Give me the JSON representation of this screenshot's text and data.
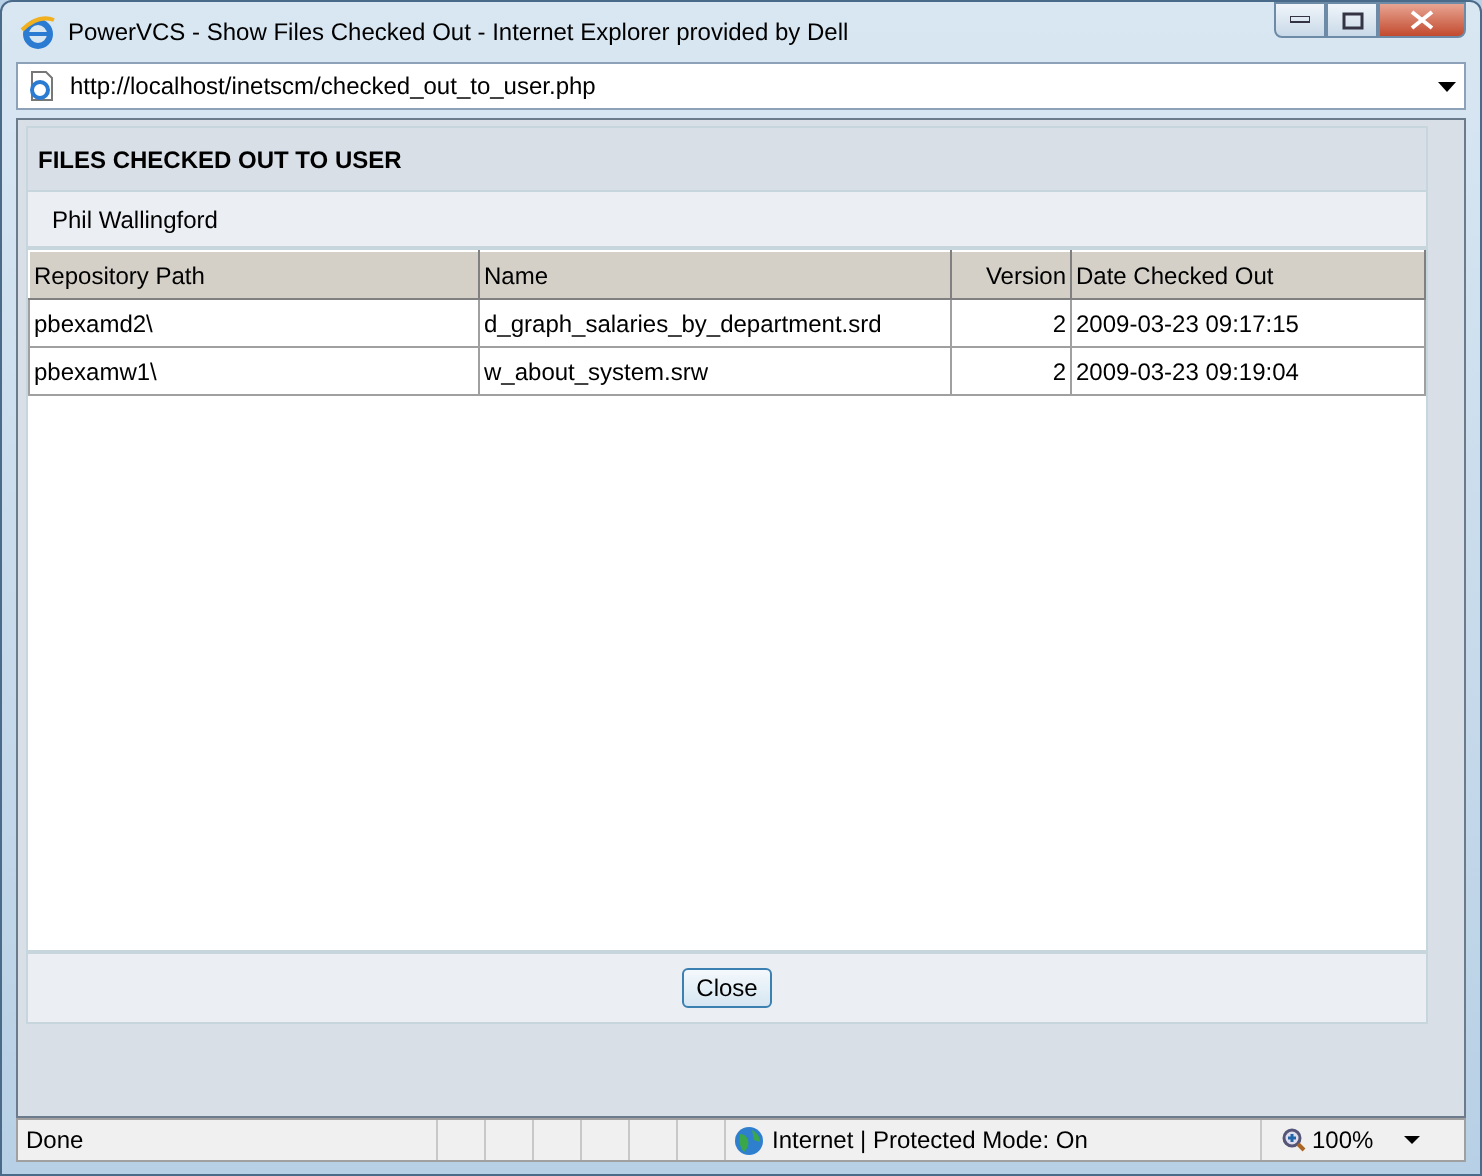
{
  "window": {
    "title": "PowerVCS - Show Files Checked Out - Internet Explorer provided by Dell"
  },
  "address_bar": {
    "url": "http://localhost/inetscm/checked_out_to_user.php"
  },
  "panel": {
    "heading": "FILES CHECKED OUT TO USER",
    "user": "Phil Wallingford"
  },
  "table": {
    "columns": [
      "Repository Path",
      "Name",
      "Version",
      "Date Checked Out"
    ],
    "rows": [
      [
        "pbexamd2\\",
        "d_graph_salaries_by_department.srd",
        "2",
        "2009-03-23 09:17:15"
      ],
      [
        "pbexamw1\\",
        "w_about_system.srw",
        "2",
        "2009-03-23 09:19:04"
      ]
    ]
  },
  "buttons": [
    "Close"
  ],
  "status_bar": {
    "status": "Done",
    "zone": "Internet | Protected Mode: On",
    "zoom": "100%"
  }
}
